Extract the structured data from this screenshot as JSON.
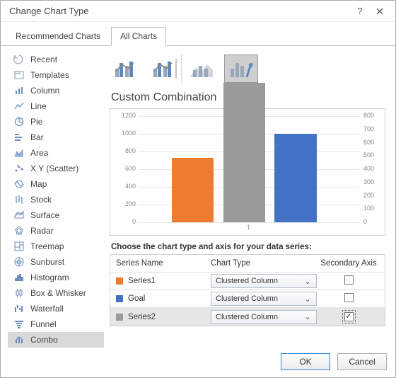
{
  "window": {
    "title": "Change Chart Type",
    "help_label": "?",
    "close_label": "✕"
  },
  "tabs": {
    "recommended": "Recommended Charts",
    "all": "All Charts",
    "active": "all"
  },
  "sidebar": {
    "items": [
      {
        "label": "Recent"
      },
      {
        "label": "Templates"
      },
      {
        "label": "Column"
      },
      {
        "label": "Line"
      },
      {
        "label": "Pie"
      },
      {
        "label": "Bar"
      },
      {
        "label": "Area"
      },
      {
        "label": "X Y (Scatter)"
      },
      {
        "label": "Map"
      },
      {
        "label": "Stock"
      },
      {
        "label": "Surface"
      },
      {
        "label": "Radar"
      },
      {
        "label": "Treemap"
      },
      {
        "label": "Sunburst"
      },
      {
        "label": "Histogram"
      },
      {
        "label": "Box & Whisker"
      },
      {
        "label": "Waterfall"
      },
      {
        "label": "Funnel"
      },
      {
        "label": "Combo"
      }
    ],
    "active_index": 18
  },
  "panel": {
    "section_title": "Custom Combination",
    "hint": "Choose the chart type and axis for your data series:",
    "selected_subtype": 3,
    "table": {
      "head": {
        "name": "Series Name",
        "type": "Chart Type",
        "axis": "Secondary Axis"
      },
      "rows": [
        {
          "swatch": "#ee7c30",
          "name": "Series1",
          "type": "Clustered Column",
          "secondary": false
        },
        {
          "swatch": "#4472c4",
          "name": "Goal",
          "type": "Clustered Column",
          "secondary": false
        },
        {
          "swatch": "#9a9a9a",
          "name": "Series2",
          "type": "Clustered Column",
          "secondary": true
        }
      ],
      "selected_row": 2
    }
  },
  "chart_data": {
    "type": "bar",
    "categories": [
      "1"
    ],
    "series": [
      {
        "name": "Series1",
        "values": [
          730
        ],
        "color": "#ee7c30",
        "axis": "primary"
      },
      {
        "name": "Series2",
        "values": [
          1050
        ],
        "color": "#9a9a9a",
        "axis": "secondary"
      },
      {
        "name": "Goal",
        "values": [
          1000
        ],
        "color": "#4472c4",
        "axis": "primary"
      }
    ],
    "y_primary": {
      "min": 0,
      "max": 1200,
      "step": 200
    },
    "y_secondary": {
      "min": 0,
      "max": 800,
      "step": 100
    },
    "title": "",
    "xlabel": "",
    "ylabel": ""
  },
  "buttons": {
    "ok": "OK",
    "cancel": "Cancel"
  },
  "colors": {
    "accent": "#2f83cf",
    "orange": "#ee7c30",
    "gray": "#9a9a9a",
    "blue": "#4472c4"
  }
}
